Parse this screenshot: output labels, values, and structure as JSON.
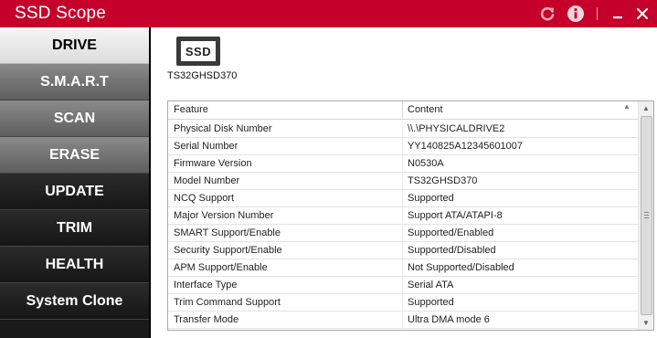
{
  "app": {
    "title": "SSD Scope",
    "accent_color": "#c5002a"
  },
  "titlebar": {
    "icons": [
      "refresh-icon",
      "info-icon",
      "minimize-icon",
      "close-icon"
    ]
  },
  "sidebar": {
    "items": [
      {
        "label": "DRIVE",
        "state": "active"
      },
      {
        "label": "S.M.A.R.T",
        "state": "light"
      },
      {
        "label": "SCAN",
        "state": "light"
      },
      {
        "label": "ERASE",
        "state": "light"
      },
      {
        "label": "UPDATE",
        "state": "dark"
      },
      {
        "label": "TRIM",
        "state": "dark"
      },
      {
        "label": "HEALTH",
        "state": "dark"
      },
      {
        "label": "System Clone",
        "state": "dark"
      }
    ]
  },
  "drive": {
    "icon_label": "SSD",
    "model": "TS32GHSD370"
  },
  "table": {
    "headers": {
      "feature": "Feature",
      "content": "Content"
    },
    "rows": [
      {
        "feature": "Physical Disk Number",
        "content": "\\\\.\\PHYSICALDRIVE2"
      },
      {
        "feature": "Serial Number",
        "content": "YY140825A12345601007"
      },
      {
        "feature": "Firmware Version",
        "content": "N0530A"
      },
      {
        "feature": "Model Number",
        "content": "TS32GHSD370"
      },
      {
        "feature": "NCQ Support",
        "content": "Supported"
      },
      {
        "feature": "Major Version Number",
        "content": "Support ATA/ATAPI-8"
      },
      {
        "feature": "SMART Support/Enable",
        "content": "Supported/Enabled"
      },
      {
        "feature": "Security Support/Enable",
        "content": "Supported/Disabled"
      },
      {
        "feature": "APM Support/Enable",
        "content": "Not Supported/Disabled"
      },
      {
        "feature": "Interface Type",
        "content": "Serial ATA"
      },
      {
        "feature": "Trim Command Support",
        "content": "Supported"
      },
      {
        "feature": "Transfer Mode",
        "content": "Ultra DMA mode 6"
      }
    ]
  }
}
